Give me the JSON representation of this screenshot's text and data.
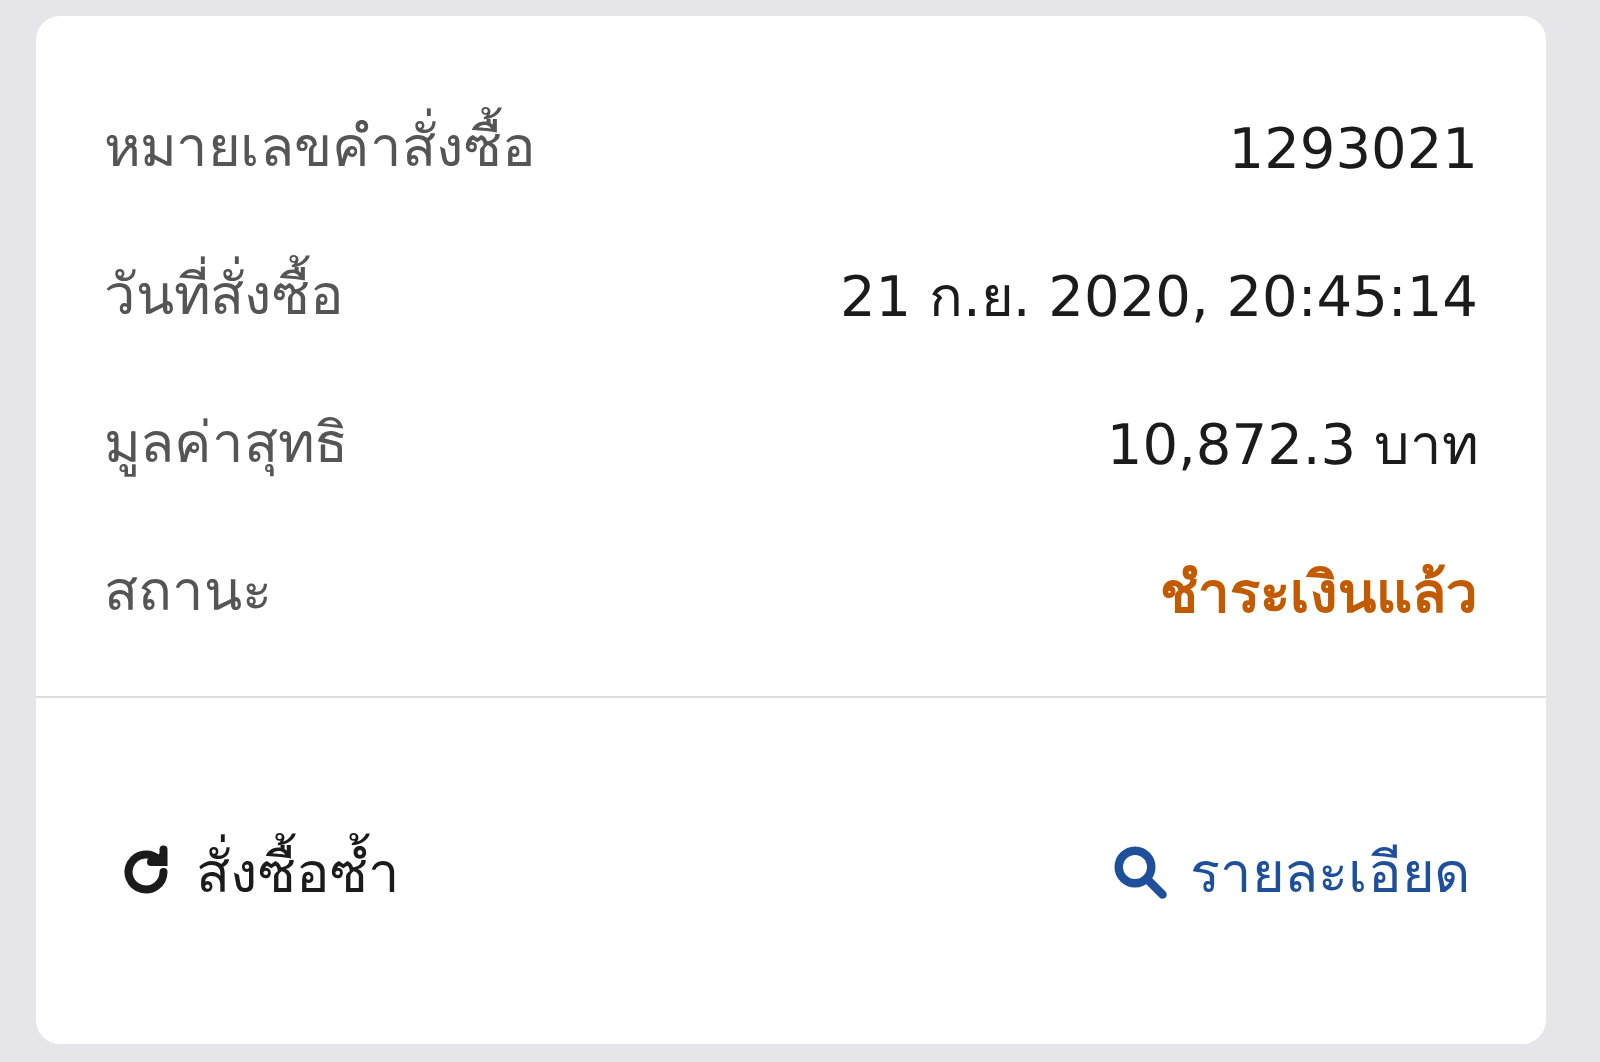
{
  "order_details": [
    {
      "label": "หมายเลขคำสั่งซื้อ",
      "value": "1293021",
      "kind": "plain"
    },
    {
      "label": "วันที่สั่งซื้อ",
      "value": "21 ก.ย. 2020, 20:45:14",
      "kind": "plain"
    },
    {
      "label": "มูลค่าสุทธิ",
      "value": "10,872.3 บาท",
      "kind": "plain"
    },
    {
      "label": "สถานะ",
      "value": "ชำระเงินแล้ว",
      "kind": "status"
    }
  ],
  "actions": {
    "reorder": "สั่งซื้อซ้ำ",
    "details": "รายละเอียด"
  }
}
